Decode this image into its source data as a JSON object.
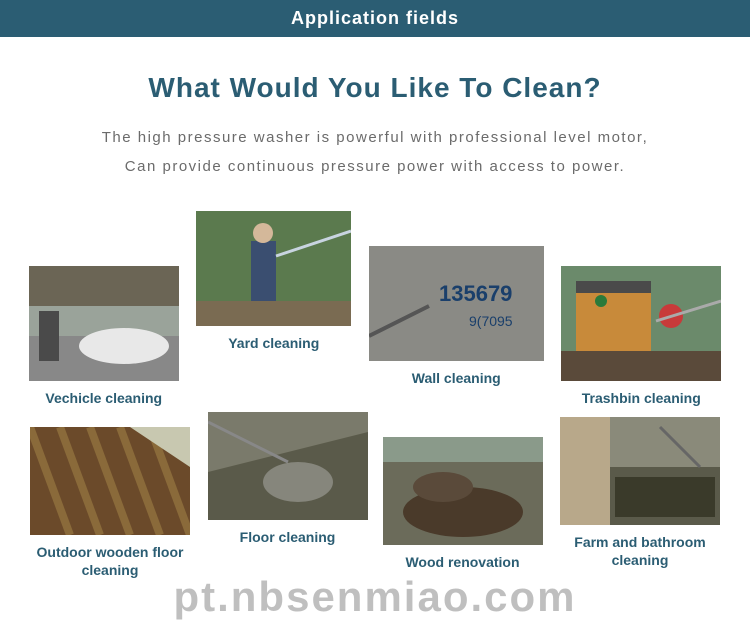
{
  "banner": "Application fields",
  "title": "What Would You Like To Clean?",
  "desc_line1": "The high pressure washer is powerful with professional level motor,",
  "desc_line2": "Can provide continuous pressure power with access to power.",
  "row1": [
    {
      "label": "Vechicle cleaning"
    },
    {
      "label": "Yard cleaning"
    },
    {
      "label": "Wall cleaning"
    },
    {
      "label": "Trashbin cleaning"
    }
  ],
  "row2": [
    {
      "label": "Outdoor wooden floor cleaning"
    },
    {
      "label": "Floor cleaning"
    },
    {
      "label": "Wood renovation"
    },
    {
      "label": "Farm and bathroom cleaning"
    }
  ],
  "watermark": "pt.nbsenmiao.com"
}
